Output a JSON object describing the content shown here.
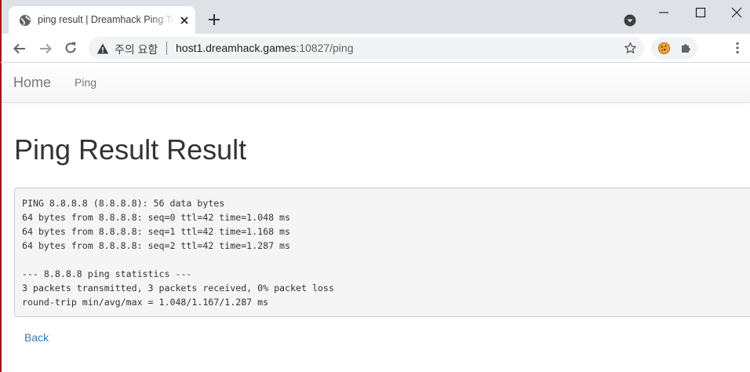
{
  "browser": {
    "tab_title": "ping result | Dreamhack Ping Tester",
    "security_label": "주의 요함",
    "url_host": "host1.dreamhack.games",
    "url_path": ":10827/ping"
  },
  "nav": {
    "brand": "Home",
    "links": [
      "Ping"
    ]
  },
  "page": {
    "heading": "Ping Result Result",
    "output_lines": [
      "PING 8.8.8.8 (8.8.8.8): 56 data bytes",
      "64 bytes from 8.8.8.8: seq=0 ttl=42 time=1.048 ms",
      "64 bytes from 8.8.8.8: seq=1 ttl=42 time=1.168 ms",
      "64 bytes from 8.8.8.8: seq=2 ttl=42 time=1.287 ms",
      "",
      "--- 8.8.8.8 ping statistics ---",
      "3 packets transmitted, 3 packets received, 0% packet loss",
      "round-trip min/avg/max = 1.048/1.167/1.287 ms"
    ],
    "back_label": "Back"
  },
  "colors": {
    "link": "#337ab7",
    "frame_accent": "#a4161a",
    "pre_background": "#f5f5f5"
  },
  "icons": [
    "globe-icon",
    "close-icon",
    "plus-icon",
    "tab-search-icon",
    "minimize-icon",
    "maximize-icon",
    "window-close-icon",
    "back-arrow-icon",
    "forward-arrow-icon",
    "reload-icon",
    "warning-icon",
    "star-icon",
    "cookie-icon",
    "puzzle-icon",
    "kebab-menu-icon"
  ]
}
